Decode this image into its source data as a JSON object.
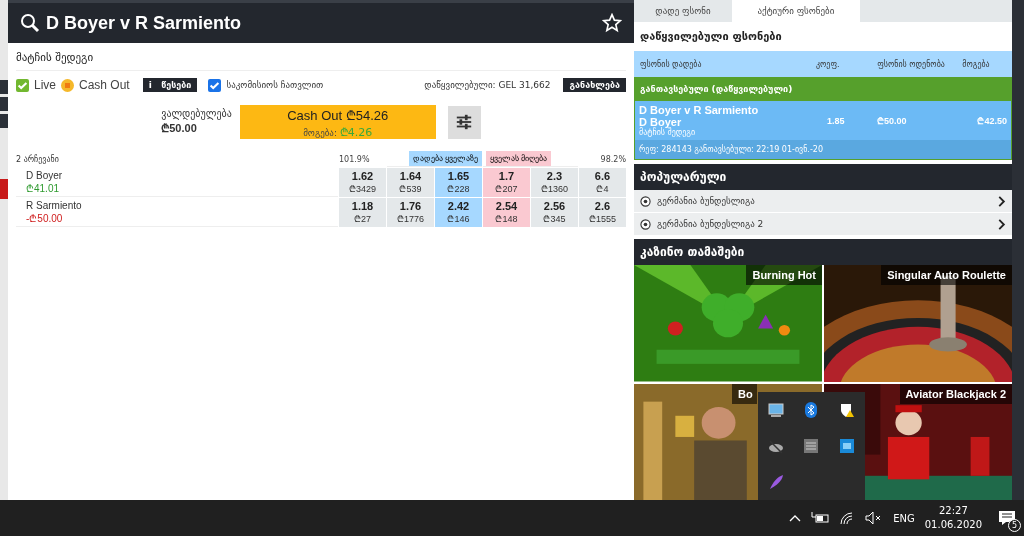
{
  "match": {
    "title": "D Boyer v R Sarmiento",
    "favorite": false
  },
  "market": {
    "title": "მატჩის შედეგი",
    "live": {
      "label": "Live",
      "checked": true
    },
    "cashout": {
      "label": "Cash Out",
      "on": true
    },
    "rules": {
      "icon": "i",
      "label": "წესები"
    },
    "commission": {
      "label": "საკომისიოს ჩათვლით",
      "checked": true
    },
    "matched": "დაწყვილებული: GEL 31,662",
    "refresh": "განახლება"
  },
  "cash_out": {
    "liability_label": "ვალდებულება",
    "liability": "₾50.00",
    "button": "Cash Out ₾54.26",
    "profit_label": "მოგება:",
    "profit": "₾4.26"
  },
  "odds": {
    "selections": "2 არჩევანი",
    "back_percent": "101.9%",
    "back_all": "დადება ყველაზე",
    "lay_all": "ყველას მიღება",
    "lay_percent": "98.2%",
    "runners": [
      {
        "name": "D Boyer",
        "position": "₾41.01",
        "kind": "profit",
        "prices": [
          {
            "kind": "back",
            "odds": "1.62",
            "amount": "₾3429"
          },
          {
            "kind": "back",
            "odds": "1.64",
            "amount": "₾539"
          },
          {
            "kind": "back_best",
            "odds": "1.65",
            "amount": "₾228"
          },
          {
            "kind": "lay_best",
            "odds": "1.7",
            "amount": "₾207"
          },
          {
            "kind": "lay",
            "odds": "2.3",
            "amount": "₾1360"
          },
          {
            "kind": "lay",
            "odds": "6.6",
            "amount": "₾4"
          }
        ]
      },
      {
        "name": "R Sarmiento",
        "position": "-₾50.00",
        "kind": "loss",
        "prices": [
          {
            "kind": "back",
            "odds": "1.18",
            "amount": "₾27"
          },
          {
            "kind": "back",
            "odds": "1.76",
            "amount": "₾1776"
          },
          {
            "kind": "back_best",
            "odds": "2.42",
            "amount": "₾146"
          },
          {
            "kind": "lay_best",
            "odds": "2.54",
            "amount": "₾148"
          },
          {
            "kind": "lay",
            "odds": "2.56",
            "amount": "₾345"
          },
          {
            "kind": "lay",
            "odds": "2.6",
            "amount": "₾1555"
          }
        ]
      }
    ]
  },
  "betslip": {
    "tabs": [
      {
        "label": "დადე ფსონი",
        "selected": false
      },
      {
        "label": "აქტიური ფსონები",
        "selected": true
      }
    ],
    "title": "დაწყვილებული ფსონები",
    "columns": [
      "ფსონის დადება",
      "კოეფ.",
      "ფსონის ოდენობა",
      "მოგება"
    ],
    "group": "განთავსებული (დაწყვილებული)",
    "bet": {
      "event": "D Boyer v R Sarmiento",
      "selection": "D Boyer",
      "market": "მატჩის შედეგი",
      "odds": "1.85",
      "stake": "₾50.00",
      "profit": "₾42.50",
      "ref": "რეფ: 284143 განთავსებული: 22:19 01-ივნ.-20"
    }
  },
  "popular": {
    "title": "პოპულარული",
    "items": [
      "გერმანია ბუნდესლიგა",
      "გერმანია ბუნდესლიგა 2"
    ]
  },
  "casino": {
    "title": "კაზინო თამაშები",
    "games": [
      {
        "title": "Burning Hot",
        "kind": "picture"
      },
      {
        "title": "Singular Auto Roulette",
        "kind": "picture"
      },
      {
        "title": "Bo",
        "kind": "picture"
      },
      {
        "title": "Aviator Blackjack 2",
        "kind": "picture"
      }
    ]
  },
  "taskbar": {
    "language": "ENG",
    "time": "22:27",
    "date": "01.06.2020",
    "notifications": "5"
  }
}
